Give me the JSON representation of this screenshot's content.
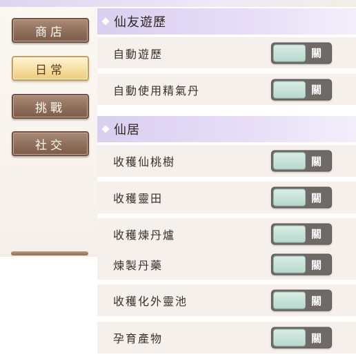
{
  "sidebar": {
    "items": [
      {
        "label": "商店",
        "active": false
      },
      {
        "label": "日常",
        "active": true
      },
      {
        "label": "挑戰",
        "active": false
      },
      {
        "label": "社交",
        "active": false
      }
    ]
  },
  "sections": [
    {
      "title": "仙友遊歷",
      "rows": [
        {
          "label": "自動遊歷",
          "toggle": "關",
          "on": false
        },
        {
          "label": "自動使用精氣丹",
          "toggle": "關",
          "on": false
        }
      ]
    },
    {
      "title": "仙居",
      "rows": [
        {
          "label": "收穫仙桃樹",
          "toggle": "關",
          "on": false
        },
        {
          "label": "收穫靈田",
          "toggle": "關",
          "on": false
        },
        {
          "label": "收穫煉丹爐",
          "toggle": "關",
          "on": false
        },
        {
          "label": "煉製丹藥",
          "toggle": "關",
          "on": false
        },
        {
          "label": "收穫化外靈池",
          "toggle": "關",
          "on": false
        },
        {
          "label": "孕育產物",
          "toggle": "關",
          "on": false
        }
      ]
    }
  ],
  "colors": {
    "accent_header": "#d9cff0",
    "toggle_track": "#6f6a67",
    "toggle_knob": "#c6e2d9",
    "nav_button": "#8e6f5c",
    "nav_active": "#f5dc9a"
  }
}
